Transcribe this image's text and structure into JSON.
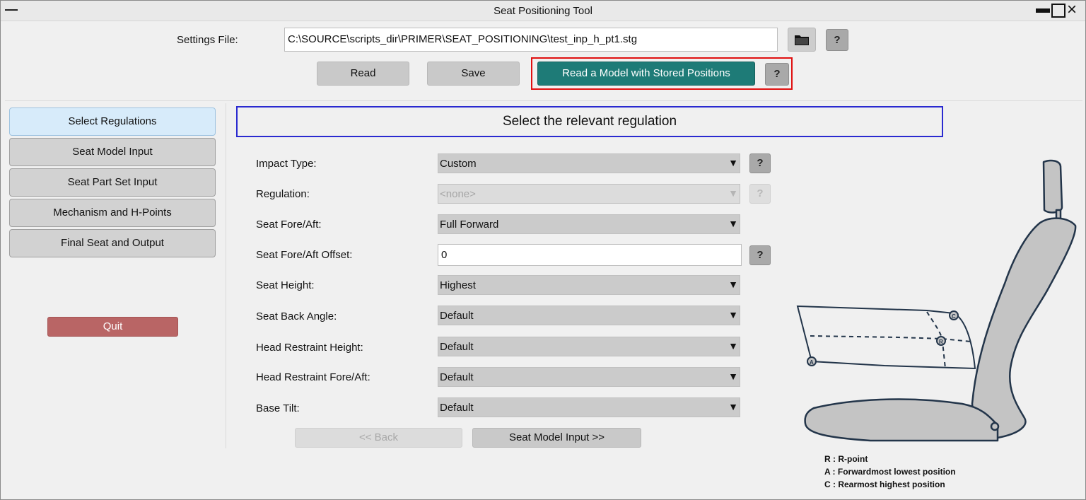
{
  "window": {
    "title": "Seat Positioning Tool",
    "min_symbol": "—"
  },
  "settings": {
    "label": "Settings File:",
    "path": "C:\\SOURCE\\scripts_dir\\PRIMER\\SEAT_POSITIONING\\test_inp_h_pt1.stg",
    "help": "?"
  },
  "actions": {
    "read": "Read",
    "save": "Save",
    "read_stored": "Read a Model with Stored Positions",
    "help": "?"
  },
  "sidebar": {
    "items": [
      {
        "label": "Select Regulations"
      },
      {
        "label": "Seat Model Input"
      },
      {
        "label": "Seat Part Set Input"
      },
      {
        "label": "Mechanism and H-Points"
      },
      {
        "label": "Final Seat and Output"
      }
    ],
    "quit": "Quit"
  },
  "main": {
    "heading": "Select the relevant regulation",
    "help": "?",
    "fields": {
      "impact_type": {
        "label": "Impact Type:",
        "value": "Custom"
      },
      "regulation": {
        "label": "Regulation:",
        "value": "<none>"
      },
      "fore_aft": {
        "label": "Seat Fore/Aft:",
        "value": "Full Forward"
      },
      "fore_aft_offset": {
        "label": "Seat Fore/Aft Offset:",
        "value": "0"
      },
      "seat_height": {
        "label": "Seat Height:",
        "value": "Highest"
      },
      "back_angle": {
        "label": "Seat Back Angle:",
        "value": "Default"
      },
      "hr_height": {
        "label": "Head Restraint Height:",
        "value": "Default"
      },
      "hr_fore_aft": {
        "label": "Head Restraint Fore/Aft:",
        "value": "Default"
      },
      "base_tilt": {
        "label": "Base Tilt:",
        "value": "Default"
      }
    },
    "back": "<< Back",
    "next": "Seat Model Input >>"
  },
  "diagram": {
    "point_labels": [
      "R",
      "A",
      "C"
    ],
    "legend": [
      "R : R-point",
      "A : Forwardmost lowest position",
      "C : Rearmost highest position"
    ]
  },
  "colors": {
    "teal": "#1e7b77",
    "quit": "#b96565",
    "highlight": "#e01010",
    "heading_border": "#2a2ad0",
    "seat_fill": "#c4c4c4",
    "seat_stroke": "#23354a"
  }
}
